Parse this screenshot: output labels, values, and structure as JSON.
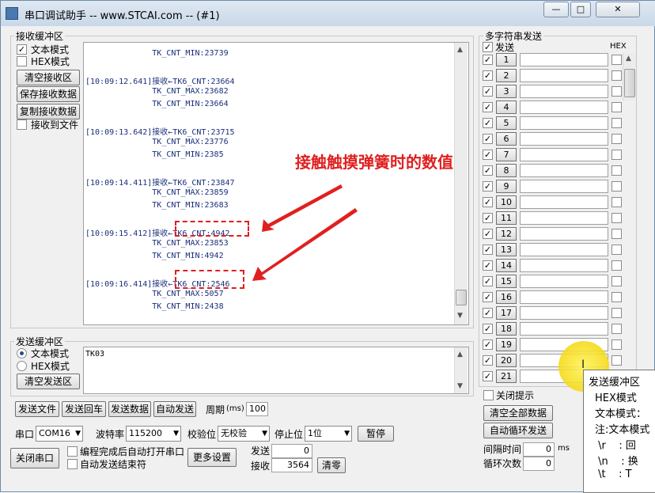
{
  "window": {
    "title": "串口调试助手 -- www.STCAI.com -- (#1)",
    "btn_min": "—",
    "btn_max": "□",
    "btn_close": "✕"
  },
  "receive": {
    "group_label": "接收缓冲区",
    "text_mode": "文本模式",
    "text_mode_checked": true,
    "hex_mode": "HEX模式",
    "clear_btn": "清空接收区",
    "save_btn": "保存接收数据",
    "copy_btn": "复制接收数据",
    "to_file": "接收到文件",
    "lines": [
      "              TK_CNT_MIN:23739",
      "",
      "[10:09:12.641]接收←TK6_CNT:23664",
      "              TK_CNT_MAX:23682",
      "              TK_CNT_MIN:23664",
      "",
      "[10:09:13.642]接收←TK6_CNT:23715",
      "              TK_CNT_MAX:23776",
      "              TK_CNT_MIN:2385",
      "",
      "[10:09:14.411]接收←TK6_CNT:23847",
      "              TK_CNT_MAX:23859",
      "              TK_CNT_MIN:23683",
      "",
      "[10:09:15.412]接收←TK6_CNT:4942",
      "              TK_CNT_MAX:23853",
      "              TK_CNT_MIN:4942",
      "",
      "[10:09:16.414]接收←TK6_CNT:2546",
      "              TK_CNT_MAX:5057",
      "              TK_CNT_MIN:2438"
    ]
  },
  "annotation": {
    "text": "接触触摸弹簧时的数值"
  },
  "send": {
    "group_label": "发送缓冲区",
    "text_mode": "文本模式",
    "hex_mode": "HEX模式",
    "clear_btn": "清空发送区",
    "content": "TK03",
    "send_file": "发送文件",
    "send_enter": "发送回车",
    "send_data": "发送数据",
    "auto_send": "自动发送",
    "period_label": "周期",
    "period_unit": "(ms)",
    "period_value": "100"
  },
  "port": {
    "port_label": "串口",
    "port_value": "COM16",
    "baud_label": "波特率",
    "baud_value": "115200",
    "parity_label": "校验位",
    "parity_value": "无校验",
    "stop_label": "停止位",
    "stop_value": "1位",
    "pause_btn": "暂停",
    "close_btn": "关闭串口",
    "auto_open": "编程完成后自动打开串口",
    "auto_close": "自动发送结束符",
    "more_btn": "更多设置",
    "send_count_label": "发送",
    "send_count": "0",
    "recv_count_label": "接收",
    "recv_count": "3564",
    "clear_count_btn": "清零"
  },
  "multi": {
    "group_label": "多字符串发送",
    "send_header": "发送",
    "hex_header": "HEX",
    "rows": [
      "1",
      "2",
      "3",
      "4",
      "5",
      "6",
      "7",
      "8",
      "9",
      "10",
      "11",
      "12",
      "13",
      "14",
      "15",
      "16",
      "17",
      "18",
      "19",
      "20",
      "21"
    ],
    "close_tip": "关闭提示",
    "clear_all": "清空全部数据",
    "auto_loop": "自动循环发送",
    "interval_label": "间隔时间",
    "interval_value": "0",
    "interval_unit": "ms",
    "loop_label": "循环次数",
    "loop_value": "0"
  },
  "tooltip": {
    "lines": [
      "发送缓冲区",
      "HEX模式",
      "文本模式：",
      "注:文本模式",
      " \\r    : 回",
      " \\n    : 换",
      " \\t    : T"
    ]
  }
}
